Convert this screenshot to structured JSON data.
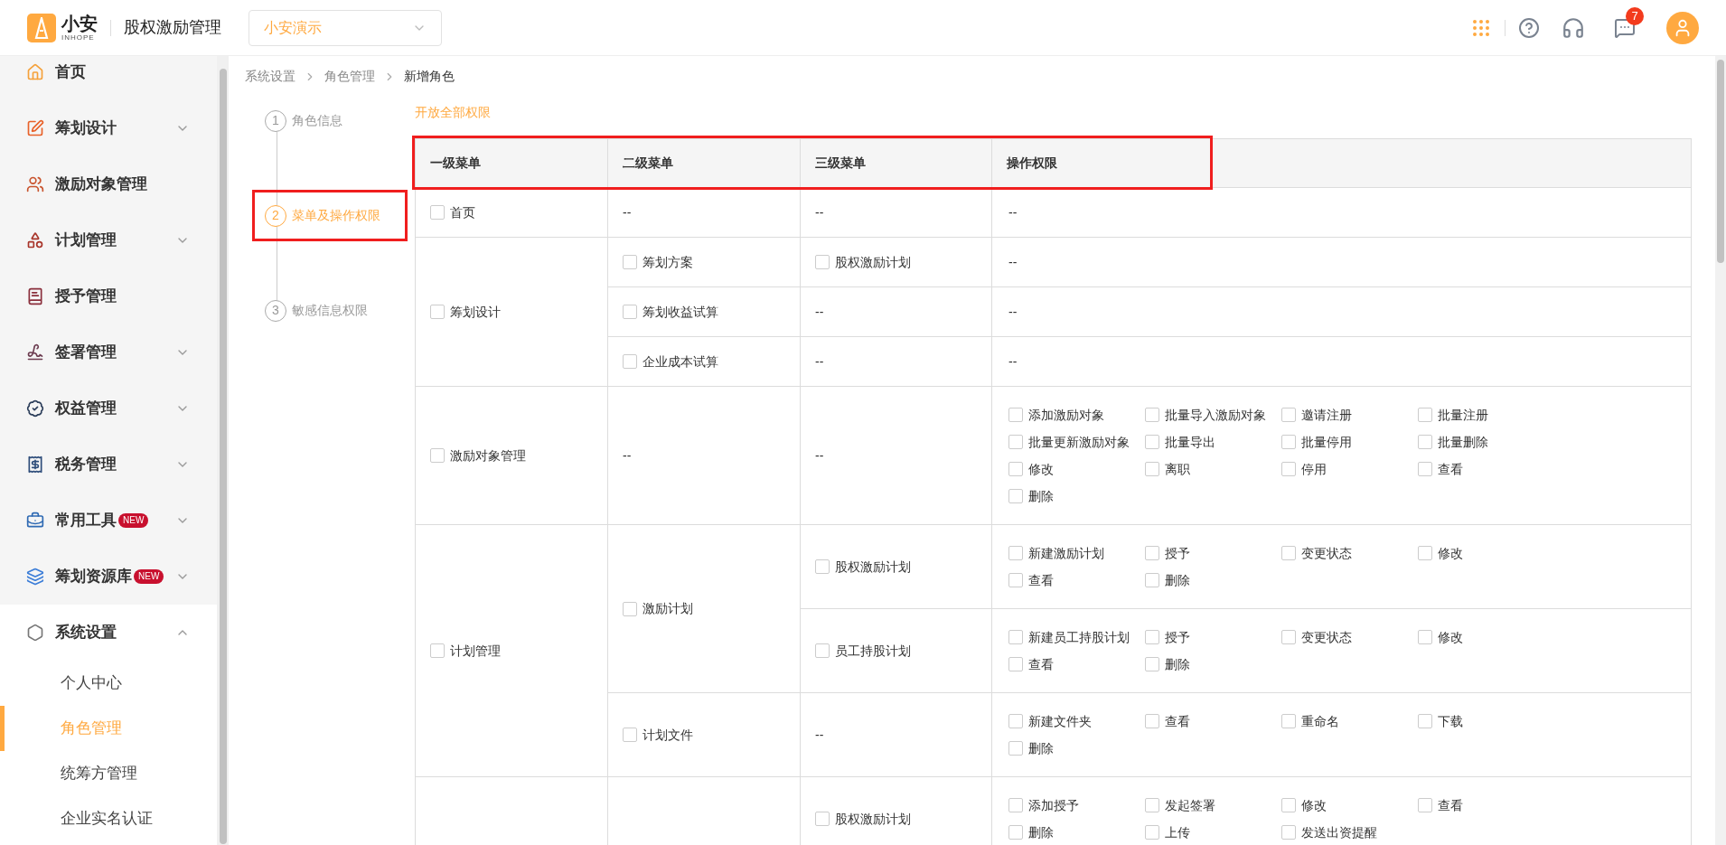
{
  "header": {
    "logo": {
      "name": "小安",
      "sub": "INHOPE"
    },
    "app_title": "股权激励管理",
    "company_select": {
      "value": "小安演示"
    },
    "message_badge": "7"
  },
  "sidebar": {
    "items": [
      {
        "label": "首页",
        "expandable": false
      },
      {
        "label": "筹划设计",
        "expandable": true,
        "expanded": false
      },
      {
        "label": "激励对象管理",
        "expandable": false
      },
      {
        "label": "计划管理",
        "expandable": true,
        "expanded": false
      },
      {
        "label": "授予管理",
        "expandable": false
      },
      {
        "label": "签署管理",
        "expandable": true,
        "expanded": false
      },
      {
        "label": "权益管理",
        "expandable": true,
        "expanded": false
      },
      {
        "label": "税务管理",
        "expandable": true,
        "expanded": false
      },
      {
        "label": "常用工具",
        "badge": "NEW",
        "expandable": true,
        "expanded": false
      },
      {
        "label": "筹划资源库",
        "badge": "NEW",
        "expandable": true,
        "expanded": false
      },
      {
        "label": "系统设置",
        "expandable": true,
        "expanded": true,
        "children": [
          {
            "label": "个人中心",
            "selected": false
          },
          {
            "label": "角色管理",
            "selected": true
          },
          {
            "label": "统筹方管理",
            "selected": false
          },
          {
            "label": "企业实名认证",
            "selected": false
          }
        ]
      }
    ]
  },
  "breadcrumb": [
    "系统设置",
    "角色管理",
    "新增角色"
  ],
  "steps": [
    {
      "number": "1",
      "label": "角色信息",
      "selected": false,
      "highlighted": false
    },
    {
      "number": "2",
      "label": "菜单及操作权限",
      "selected": true,
      "highlighted": true
    },
    {
      "number": "3",
      "label": "敏感信息权限",
      "selected": false,
      "highlighted": false
    }
  ],
  "open_all_link": "开放全部权限",
  "table": {
    "header_highlighted": true,
    "columns": [
      "一级菜单",
      "二级菜单",
      "三级菜单",
      "操作权限"
    ],
    "groups": [
      {
        "kind": "checkbox",
        "label": "首页",
        "checked": false,
        "subs": [
          {
            "kind": "text",
            "label": "--",
            "thirds": [
              {
                "kind": "text",
                "label": "--",
                "actions_text": "--"
              }
            ]
          }
        ]
      },
      {
        "kind": "checkbox",
        "label": "筹划设计",
        "checked": false,
        "subs": [
          {
            "kind": "checkbox",
            "label": "筹划方案",
            "checked": false,
            "thirds": [
              {
                "kind": "checkbox",
                "label": "股权激励计划",
                "checked": false,
                "actions_text": "--"
              }
            ]
          },
          {
            "kind": "checkbox",
            "label": "筹划收益试算",
            "checked": false,
            "thirds": [
              {
                "kind": "text",
                "label": "--",
                "actions_text": "--"
              }
            ]
          },
          {
            "kind": "checkbox",
            "label": "企业成本试算",
            "checked": false,
            "thirds": [
              {
                "kind": "text",
                "label": "--",
                "actions_text": "--"
              }
            ]
          }
        ]
      },
      {
        "kind": "checkbox",
        "label": "激励对象管理",
        "checked": false,
        "subs": [
          {
            "kind": "text",
            "label": "--",
            "thirds": [
              {
                "kind": "text",
                "label": "--",
                "actions": [
                  {
                    "label": "添加激励对象",
                    "checked": false
                  },
                  {
                    "label": "批量导入激励对象",
                    "checked": false
                  },
                  {
                    "label": "邀请注册",
                    "checked": false
                  },
                  {
                    "label": "批量注册",
                    "checked": false
                  },
                  {
                    "label": "批量更新激励对象",
                    "checked": false
                  },
                  {
                    "label": "批量导出",
                    "checked": false
                  },
                  {
                    "label": "批量停用",
                    "checked": false
                  },
                  {
                    "label": "批量删除",
                    "checked": false
                  },
                  {
                    "label": "修改",
                    "checked": false
                  },
                  {
                    "label": "离职",
                    "checked": false
                  },
                  {
                    "label": "停用",
                    "checked": false
                  },
                  {
                    "label": "查看",
                    "checked": false
                  },
                  {
                    "label": "删除",
                    "checked": false
                  }
                ]
              }
            ]
          }
        ]
      },
      {
        "kind": "checkbox",
        "label": "计划管理",
        "checked": false,
        "subs": [
          {
            "kind": "checkbox",
            "label": "激励计划",
            "checked": false,
            "thirds": [
              {
                "kind": "checkbox",
                "label": "股权激励计划",
                "checked": false,
                "actions": [
                  {
                    "label": "新建激励计划",
                    "checked": false
                  },
                  {
                    "label": "授予",
                    "checked": false
                  },
                  {
                    "label": "变更状态",
                    "checked": false
                  },
                  {
                    "label": "修改",
                    "checked": false
                  },
                  {
                    "label": "查看",
                    "checked": false
                  },
                  {
                    "label": "删除",
                    "checked": false
                  }
                ]
              },
              {
                "kind": "checkbox",
                "label": "员工持股计划",
                "checked": false,
                "actions": [
                  {
                    "label": "新建员工持股计划",
                    "checked": false
                  },
                  {
                    "label": "授予",
                    "checked": false
                  },
                  {
                    "label": "变更状态",
                    "checked": false
                  },
                  {
                    "label": "修改",
                    "checked": false
                  },
                  {
                    "label": "查看",
                    "checked": false
                  },
                  {
                    "label": "删除",
                    "checked": false
                  }
                ]
              }
            ]
          },
          {
            "kind": "checkbox",
            "label": "计划文件",
            "checked": false,
            "thirds": [
              {
                "kind": "text",
                "label": "--",
                "actions": [
                  {
                    "label": "新建文件夹",
                    "checked": false
                  },
                  {
                    "label": "查看",
                    "checked": false
                  },
                  {
                    "label": "重命名",
                    "checked": false
                  },
                  {
                    "label": "下载",
                    "checked": false
                  },
                  {
                    "label": "删除",
                    "checked": false
                  }
                ]
              }
            ]
          }
        ]
      },
      {
        "kind": "blank",
        "subs": [
          {
            "kind": "blank",
            "thirds": [
              {
                "kind": "checkbox",
                "label": "股权激励计划",
                "checked": false,
                "actions": [
                  {
                    "label": "添加授予",
                    "checked": false
                  },
                  {
                    "label": "发起签署",
                    "checked": false
                  },
                  {
                    "label": "修改",
                    "checked": false
                  },
                  {
                    "label": "查看",
                    "checked": false
                  },
                  {
                    "label": "删除",
                    "checked": false
                  },
                  {
                    "label": "上传",
                    "checked": false
                  },
                  {
                    "label": "发送出资提醒",
                    "checked": false
                  }
                ]
              }
            ]
          }
        ]
      }
    ]
  }
}
